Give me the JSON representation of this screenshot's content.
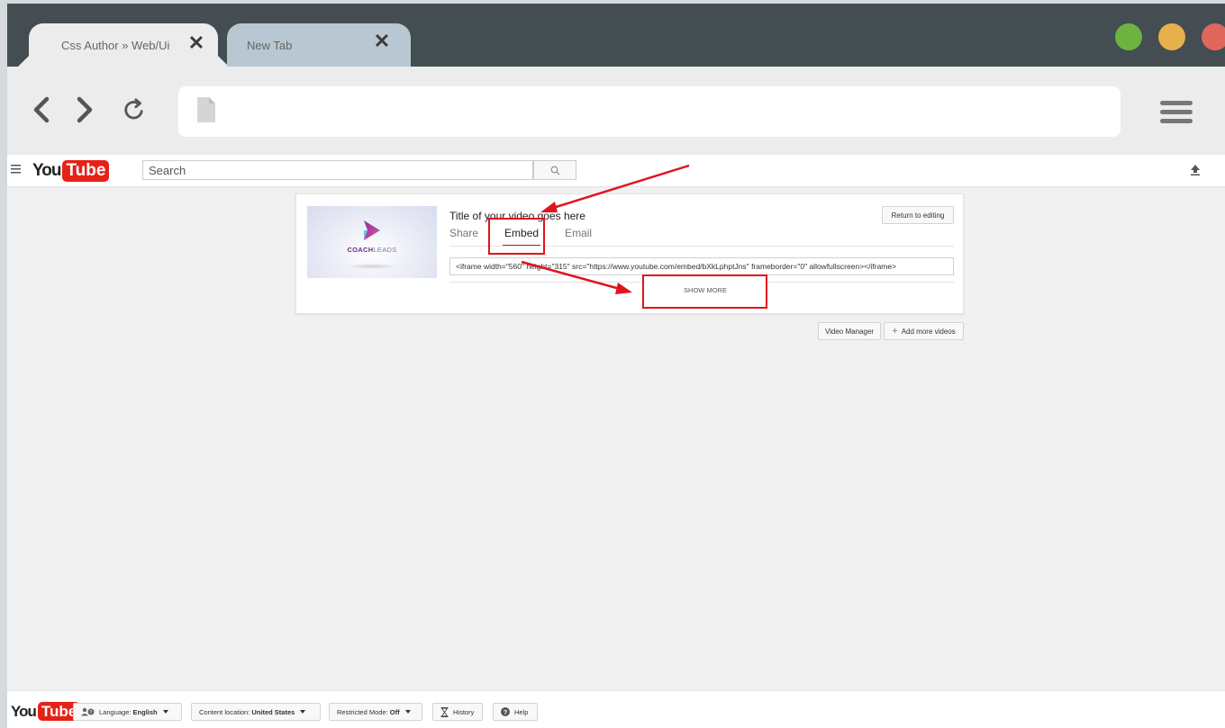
{
  "browser": {
    "tabs": [
      {
        "label": "Css Author » Web/Ui",
        "active": true
      },
      {
        "label": "New Tab",
        "active": false
      }
    ],
    "close_glyph": "✕",
    "window_controls": {
      "green": "#6cb33f",
      "yellow": "#e6b04a",
      "red": "#e0675b"
    },
    "address": ""
  },
  "youtube": {
    "logo": {
      "you": "You",
      "tube": "Tube"
    },
    "search": {
      "placeholder": "Search"
    },
    "video": {
      "title": "Title of your video goes here",
      "thumbnail_brand_bold": "COACH",
      "thumbnail_brand_light": "LEADS"
    },
    "share_tabs": [
      "Share",
      "Embed",
      "Email"
    ],
    "active_share_tab": "Embed",
    "return_label": "Return to editing",
    "embed_code": "<iframe width=\"560\" height=\"315\" src=\"https://www.youtube.com/embed/bXkLphptJns\" frameborder=\"0\" allowfullscreen></iframe>",
    "show_more_label": "SHOW MORE",
    "video_manager_label": "Video Manager",
    "add_more_videos_label": "Add more videos",
    "add_more_videos_prefix": "+"
  },
  "footer": {
    "logo": {
      "you": "You",
      "tube": "Tube"
    },
    "language_prefix": "Language:",
    "language_value": "English",
    "location_prefix": "Content location:",
    "location_value": "United States",
    "restricted_prefix": "Restricted Mode:",
    "restricted_value": "Off",
    "history_label": "History",
    "help_label": "Help"
  },
  "colors": {
    "youtube_red": "#e62117",
    "annotation_red": "#e0141b",
    "chrome_dark": "#444d52"
  }
}
